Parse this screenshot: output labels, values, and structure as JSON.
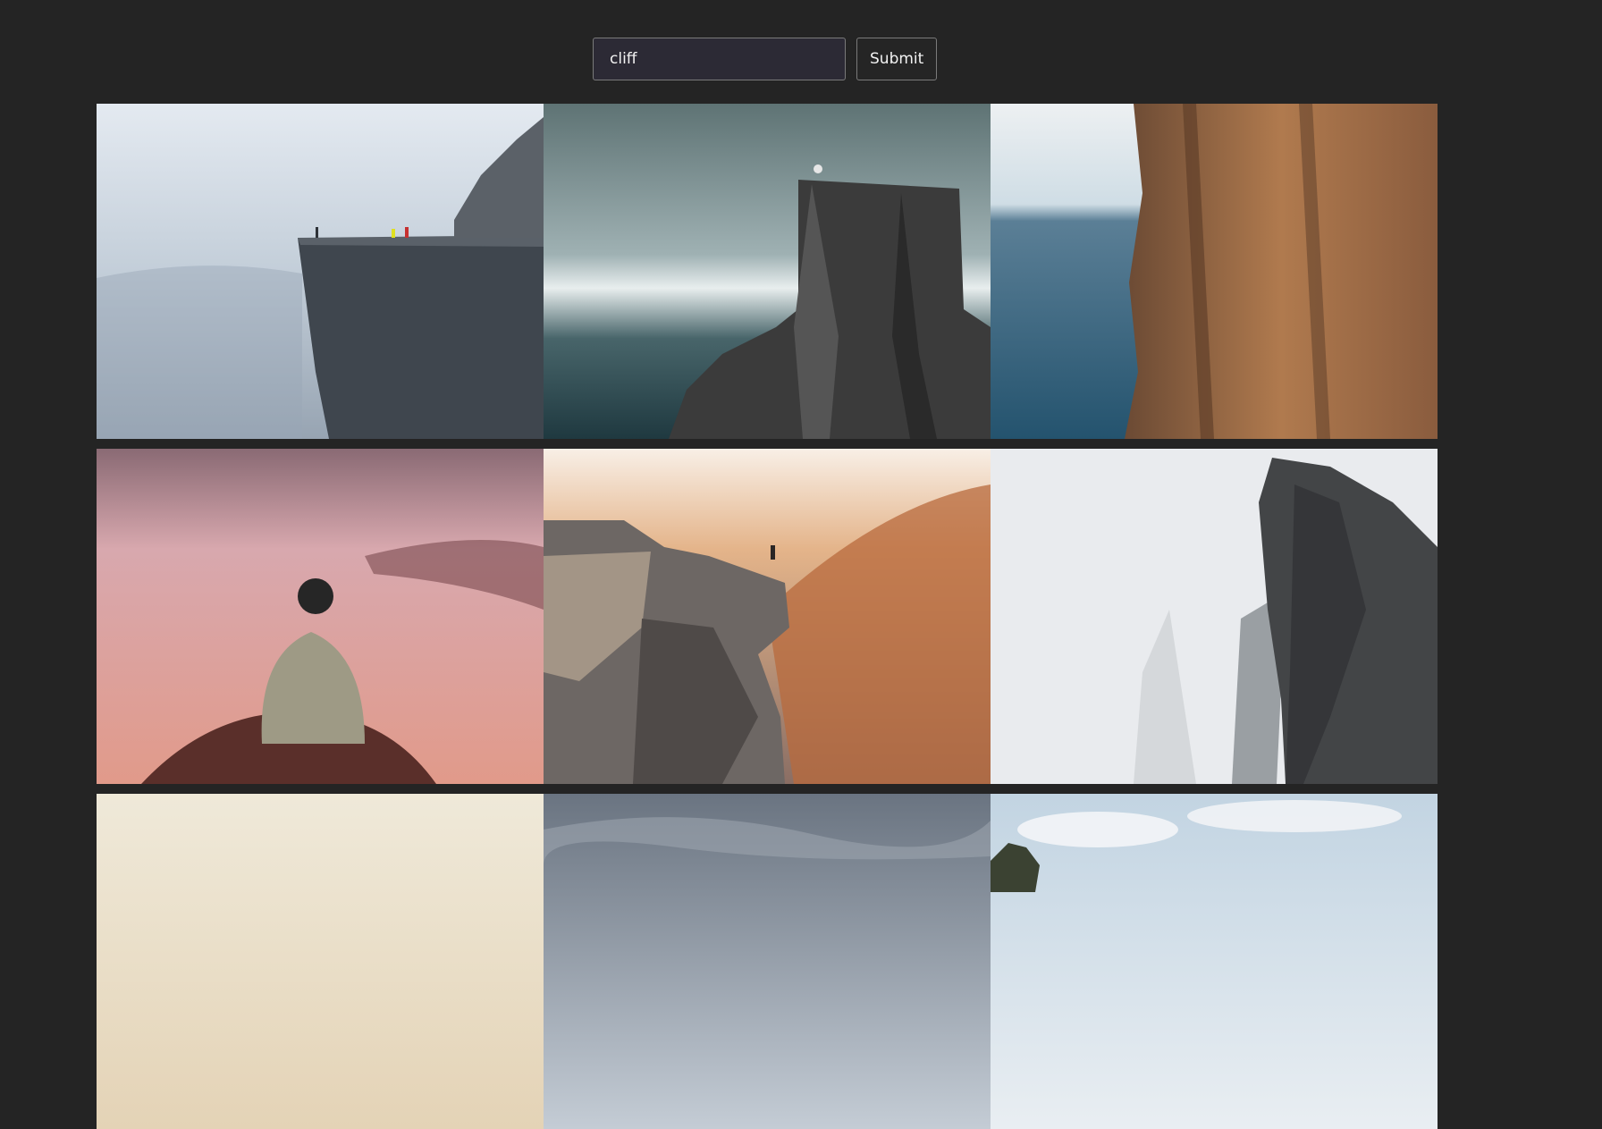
{
  "search": {
    "query": "cliff",
    "submit_label": "Submit"
  },
  "gallery": {
    "photos": [
      {
        "subject": "cliff-fog-people"
      },
      {
        "subject": "cliff-sea-rock"
      },
      {
        "subject": "cliff-ocean-face"
      },
      {
        "subject": "hooded-person-clouds"
      },
      {
        "subject": "person-cliff-sunset"
      },
      {
        "subject": "cliff-mist-rock"
      },
      {
        "subject": "sky-warm"
      },
      {
        "subject": "sky-storm"
      },
      {
        "subject": "sky-clouds-tree"
      }
    ]
  }
}
